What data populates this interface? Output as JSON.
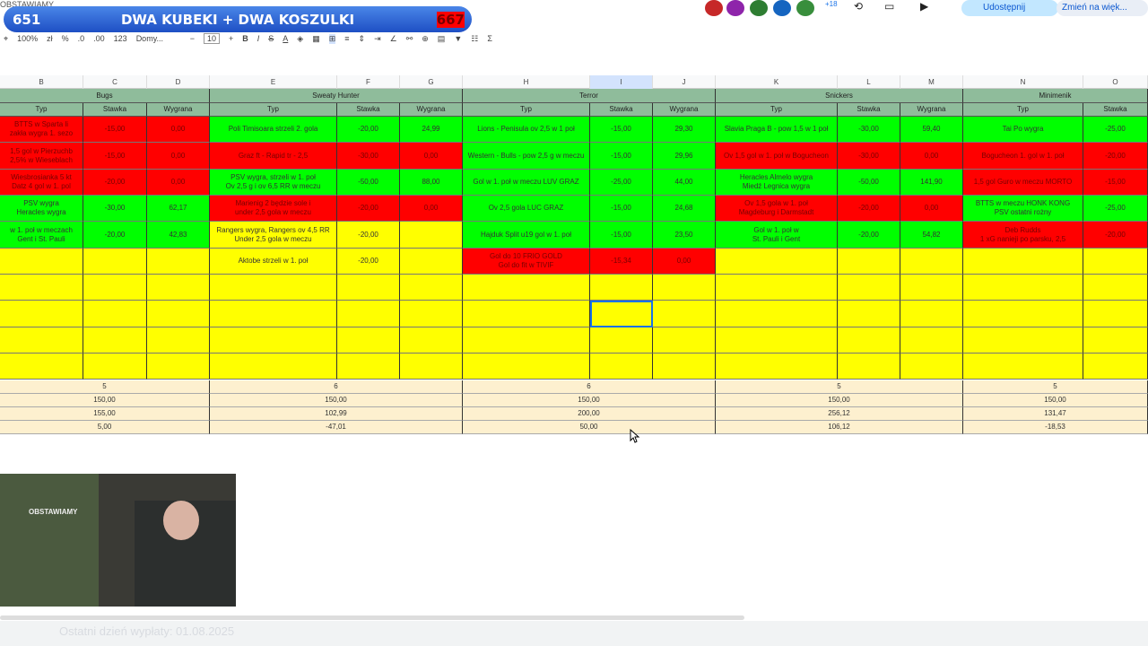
{
  "banner": {
    "left": "651",
    "title": "DWA KUBEKI + DWA KOSZULKI",
    "right": "667"
  },
  "title_fragment": "OBSTAWIAMY",
  "toolbar": {
    "zoom": "100%",
    "currency": "zł",
    "percent": "%",
    "dec_less": ".0",
    "dec_more": ".00",
    "format_123": "123",
    "font": "Domy...",
    "minus": "−",
    "font_size": "10",
    "plus": "+",
    "bold": "B",
    "italic": "I",
    "strike": "S",
    "text_color": "A",
    "sum": "Σ"
  },
  "right": {
    "share": "Udostępnij",
    "resize": "Zmień na więk...",
    "badge": "+18"
  },
  "columns": [
    "B",
    "C",
    "D",
    "E",
    "F",
    "G",
    "H",
    "I",
    "J",
    "K",
    "L",
    "M",
    "N",
    "O"
  ],
  "groups": [
    {
      "name": "Bugs",
      "cols": [
        "Typ",
        "Stawka",
        "Wygrana"
      ],
      "rows": [
        [
          "BTTS w Sparta li\nzakła wygra 1. sezo",
          "-15,00",
          "0,00",
          "r"
        ],
        [
          "1,5 gol w Pierzuchb\n2,5% w Wieseblach",
          "-15,00",
          "0,00",
          "r"
        ],
        [
          "Wiesbrosianka 5 kt\nDatz 4 gol w 1. pol",
          "-20,00",
          "0,00",
          "r"
        ],
        [
          "PSV wygra\nHeracles wygra",
          "-30,00",
          "62,17",
          "g"
        ],
        [
          "w 1. poł w meczach\nGent i St. Pauli",
          "-20,00",
          "42,83",
          "g"
        ],
        [
          "",
          "",
          "",
          "y"
        ],
        [
          "",
          "",
          "",
          "y"
        ],
        [
          "",
          "",
          "",
          "y"
        ],
        [
          "",
          "",
          "",
          "y"
        ],
        [
          "",
          "",
          "",
          "y"
        ]
      ],
      "count": "5",
      "stake": "150,00",
      "won": "155,00",
      "profit": "5,00"
    },
    {
      "name": "Sweaty Hunter",
      "cols": [
        "Typ",
        "Stawka",
        "Wygrana"
      ],
      "rows": [
        [
          "Poli Timisoara strzeli 2. gola",
          "-20,00",
          "24,99",
          "g"
        ],
        [
          "Graz ft - Rapid tr - 2,5",
          "-30,00",
          "0,00",
          "r"
        ],
        [
          "PSV wygra, strzeli w 1. poł\nOv 2,5 g i ov 6,5 RR w meczu",
          "-50,00",
          "88,00",
          "g"
        ],
        [
          "Marienig 2 będzie sole i\nunder 2,5 gola w meczu",
          "-20,00",
          "0,00",
          "r"
        ],
        [
          "Rangers wygra, Rangers ov 4,5 RR\nUnder 2,5 gola w meczu",
          "-20,00",
          "",
          "y"
        ],
        [
          "Aktobe strzeli w 1. poł",
          "-20,00",
          "",
          "y"
        ],
        [
          "",
          "",
          "",
          "y"
        ],
        [
          "",
          "",
          "",
          "y"
        ],
        [
          "",
          "",
          "",
          "y"
        ],
        [
          "",
          "",
          "",
          "y"
        ]
      ],
      "count": "6",
      "stake": "150,00",
      "won": "102,99",
      "profit": "-47,01"
    },
    {
      "name": "Terror",
      "cols": [
        "Typ",
        "Stawka",
        "Wygrana"
      ],
      "rows": [
        [
          "Lions - Penisula ov 2,5 w 1 poł",
          "-15,00",
          "29,30",
          "g"
        ],
        [
          "Western - Bulls - pow 2,5 g w meczu",
          "-15,00",
          "29,96",
          "g"
        ],
        [
          "Gol w 1. poł w meczu LUV GRAZ",
          "-25,00",
          "44,00",
          "g"
        ],
        [
          "Ov 2,5 gola LUC GRAZ",
          "-15,00",
          "24,68",
          "g"
        ],
        [
          "Hajduk Split u19 gol w 1. poł",
          "-15,00",
          "23,50",
          "g"
        ],
        [
          "Gol do 10 FRIO GOLD\nGol do fit w TIVIF",
          "-15,34",
          "0,00",
          "r"
        ],
        [
          "",
          "",
          "",
          "y"
        ],
        [
          "",
          "",
          "",
          "y"
        ],
        [
          "",
          "",
          "",
          "y"
        ],
        [
          "",
          "",
          "",
          "y"
        ]
      ],
      "count": "6",
      "stake": "150,00",
      "won": "200,00",
      "profit": "50,00"
    },
    {
      "name": "Snickers",
      "cols": [
        "Typ",
        "Stawka",
        "Wygrana"
      ],
      "rows": [
        [
          "Slavia Praga B - pow 1,5 w 1 poł",
          "-30,00",
          "59,40",
          "g"
        ],
        [
          "Ov 1,5 gol w 1. poł w Bogucheon",
          "-30,00",
          "0,00",
          "r"
        ],
        [
          "Heracles Almelo wygra\nMiedź Legnica wygra",
          "-50,00",
          "141,90",
          "g"
        ],
        [
          "Ov 1,5 gola w 1. poł\nMagdeburg i Darmstadt",
          "-20,00",
          "0,00",
          "r"
        ],
        [
          "Gol w 1. poł w\nSt. Pauli i Gent",
          "-20,00",
          "54,82",
          "g"
        ],
        [
          "",
          "",
          "",
          "y"
        ],
        [
          "",
          "",
          "",
          "y"
        ],
        [
          "",
          "",
          "",
          "y"
        ],
        [
          "",
          "",
          "",
          "y"
        ],
        [
          "",
          "",
          "",
          "y"
        ]
      ],
      "count": "5",
      "stake": "150,00",
      "won": "256,12",
      "profit": "106,12"
    },
    {
      "name": "Minimenik",
      "cols": [
        "Typ",
        "Stawka"
      ],
      "rows": [
        [
          "Tai Po wygra",
          "-25,00",
          "",
          "g"
        ],
        [
          "Bogucheon 1. gol w 1. poł",
          "-20,00",
          "",
          "r"
        ],
        [
          "1,5 gol Guro w meczu MORTO",
          "-15,00",
          "",
          "r"
        ],
        [
          "BTTS w meczu HONK KONG\nPSV ostatni rożny",
          "-25,00",
          "",
          "g"
        ],
        [
          "Deb Rudds\n1 xG nanieji po parsku, 2,5",
          "-20,00",
          "",
          "r"
        ],
        [
          "",
          "",
          "",
          "y"
        ],
        [
          "",
          "",
          "",
          "y"
        ],
        [
          "",
          "",
          "",
          "y"
        ],
        [
          "",
          "",
          "",
          "y"
        ],
        [
          "",
          "",
          "",
          "y"
        ]
      ],
      "count": "5",
      "stake": "150,00",
      "won": "131,47",
      "profit": "-18,53"
    }
  ],
  "webcam_shirt": "OBSTAWIAMY",
  "sheet_tab": "Ostatni dzień wypłaty: 01.08.2025"
}
